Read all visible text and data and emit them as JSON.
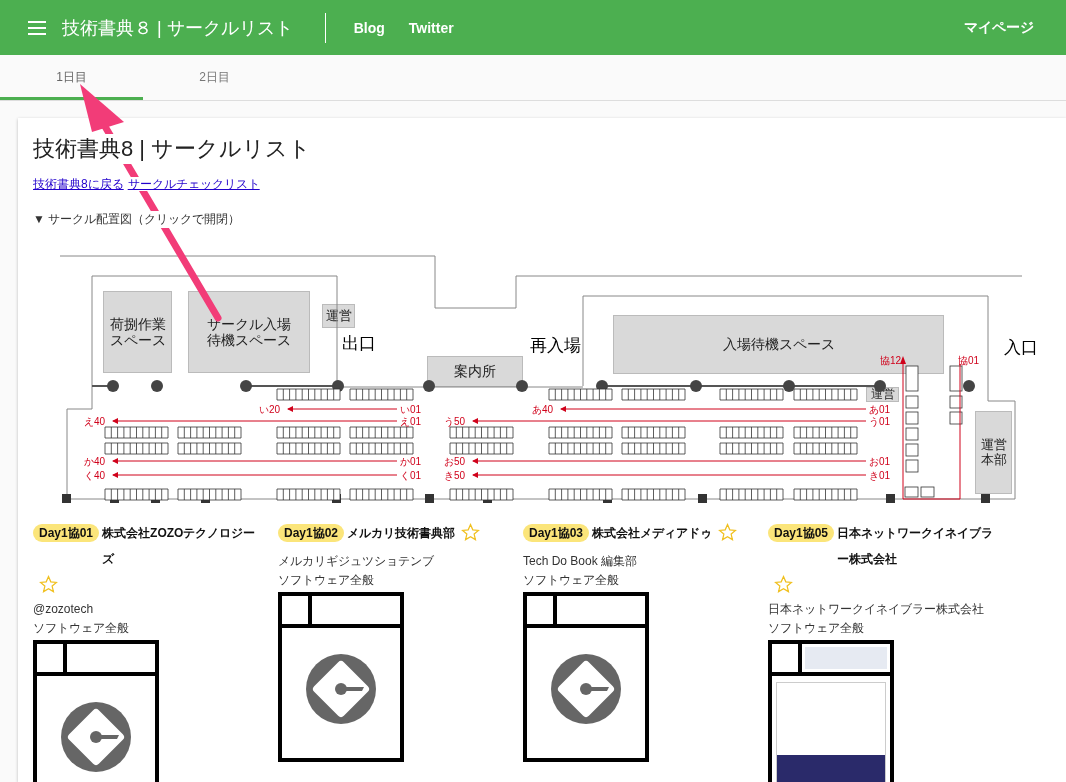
{
  "header": {
    "title": "技術書典８ | サークルリスト",
    "links": [
      "Blog",
      "Twitter"
    ],
    "account": "マイページ"
  },
  "tabs": [
    {
      "label": "1日目",
      "selected": true
    },
    {
      "label": "2日目",
      "selected": false
    }
  ],
  "page": {
    "title": "技術書典8 | サークルリスト",
    "links": [
      "技術書典8に戻る",
      "サークルチェックリスト"
    ],
    "summary": "▼ サークル配置図（クリックで開閉）"
  },
  "map": {
    "areas": [
      "荷捌作業スペース",
      "サークル入場待機スペース",
      "運営",
      "案内所",
      "入場待機スペース",
      "運営",
      "運営本部"
    ],
    "labels": [
      "出口",
      "再入場",
      "入口"
    ],
    "routes": [
      {
        "from": "い01",
        "to": "い20"
      },
      {
        "from": "あ01",
        "to": "あ40"
      },
      {
        "from": "え01",
        "to": "え40"
      },
      {
        "from": "う01",
        "to": "う50"
      },
      {
        "from": "か01",
        "to": "か40"
      },
      {
        "from": "お01",
        "to": "お50"
      },
      {
        "from": "く01",
        "to": "く40"
      },
      {
        "from": "き01",
        "to": "き50"
      }
    ],
    "staff_labels": [
      "協12",
      "協01"
    ]
  },
  "circles": [
    {
      "badge": "Day1協01",
      "name": "株式会社ZOZOテクノロジーズ",
      "favorite": false,
      "lines": [
        "@zozotech",
        "ソフトウェア全般"
      ],
      "kind": "logo"
    },
    {
      "badge": "Day1協02",
      "name": "メルカリ技術書典部",
      "favorite": false,
      "lines": [
        "メルカリギジュツショテンブ",
        "ソフトウェア全般"
      ],
      "kind": "logo"
    },
    {
      "badge": "Day1協03",
      "name": "株式会社メディアドゥ",
      "favorite": false,
      "lines": [
        "Tech Do Book 編集部",
        "ソフトウェア全般"
      ],
      "kind": "logo"
    },
    {
      "badge": "Day1協05",
      "name": "日本ネットワークイネイブラー株式会社",
      "favorite": false,
      "lines": [
        "日本ネットワークイネイブラー株式会社",
        "ソフトウェア全般"
      ],
      "kind": "cover"
    }
  ]
}
